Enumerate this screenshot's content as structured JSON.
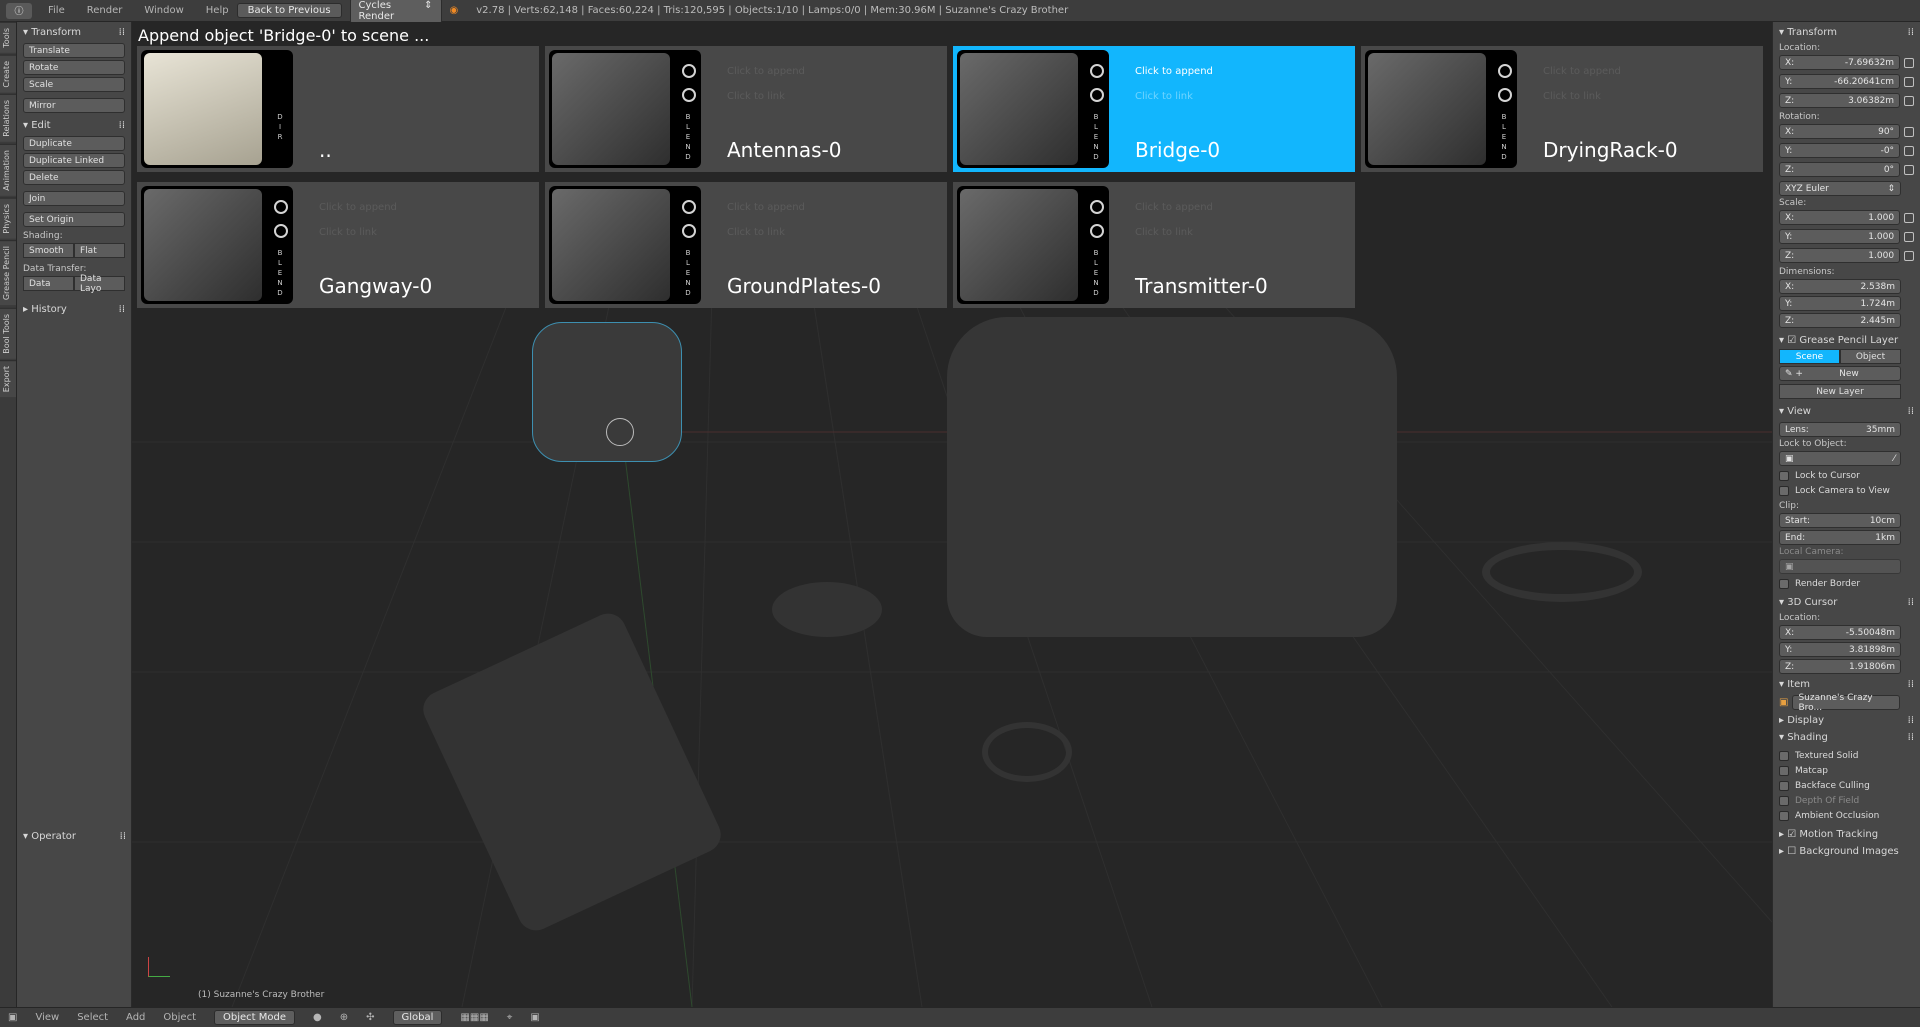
{
  "topbar": {
    "menus": [
      "File",
      "Render",
      "Window",
      "Help"
    ],
    "back_label": "Back to Previous",
    "render_engine": "Cycles Render",
    "stats": "v2.78 | Verts:62,148 | Faces:60,224 | Tris:120,595 | Objects:1/10 | Lamps:0/0 | Mem:30.96M | Suzanne's Crazy Brother"
  },
  "tabs": [
    "Tools",
    "Create",
    "Relations",
    "Animation",
    "Physics",
    "Grease Pencil",
    "Bool Tools",
    "Export"
  ],
  "toolshelf": {
    "transform_title": "Transform",
    "translate": "Translate",
    "rotate": "Rotate",
    "scale": "Scale",
    "mirror": "Mirror",
    "edit_title": "Edit",
    "duplicate": "Duplicate",
    "duplicate_linked": "Duplicate Linked",
    "delete": "Delete",
    "join": "Join",
    "set_origin": "Set Origin",
    "shading_label": "Shading:",
    "smooth": "Smooth",
    "flat": "Flat",
    "data_transfer_label": "Data Transfer:",
    "data": "Data",
    "data_layo": "Data Layo",
    "history": "History",
    "operator": "Operator"
  },
  "viewport": {
    "status": "Append object 'Bridge-0' to scene ...",
    "object_label": "(1) Suzanne's Crazy Brother"
  },
  "browser": {
    "click_append": "Click to append",
    "click_link": "Click to link",
    "items": [
      {
        "name": "..",
        "type": "D\nI\nR",
        "selected": false
      },
      {
        "name": "Antennas-0",
        "type": "B\nL\nE\nN\nD",
        "selected": false
      },
      {
        "name": "Bridge-0",
        "type": "B\nL\nE\nN\nD",
        "selected": true
      },
      {
        "name": "DryingRack-0",
        "type": "B\nL\nE\nN\nD",
        "selected": false
      },
      {
        "name": "Gangway-0",
        "type": "B\nL\nE\nN\nD",
        "selected": false
      },
      {
        "name": "GroundPlates-0",
        "type": "B\nL\nE\nN\nD",
        "selected": false
      },
      {
        "name": "Transmitter-0",
        "type": "B\nL\nE\nN\nD",
        "selected": false
      }
    ]
  },
  "properties": {
    "transform_title": "Transform",
    "location_label": "Location:",
    "loc_x": "-7.69632m",
    "loc_y": "-66.20641cm",
    "loc_z": "3.06382m",
    "rotation_label": "Rotation:",
    "rot_x": "90°",
    "rot_y": "-0°",
    "rot_z": "0°",
    "rotation_mode": "XYZ Euler",
    "scale_label": "Scale:",
    "scale_x": "1.000",
    "scale_y": "1.000",
    "scale_z": "1.000",
    "dimensions_label": "Dimensions:",
    "dim_x": "2.538m",
    "dim_y": "1.724m",
    "dim_z": "2.445m",
    "grease_title": "Grease Pencil Layer",
    "scene_tab": "Scene",
    "object_tab": "Object",
    "new_btn": "New",
    "new_layer": "New Layer",
    "view_title": "View",
    "lens_label": "Lens:",
    "lens_value": "35mm",
    "lock_to_object": "Lock to Object:",
    "lock_to_cursor": "Lock to Cursor",
    "lock_camera": "Lock Camera to View",
    "clip_label": "Clip:",
    "clip_start_label": "Start:",
    "clip_start": "10cm",
    "clip_end_label": "End:",
    "clip_end": "1km",
    "local_camera": "Local Camera:",
    "render_border": "Render Border",
    "cursor_title": "3D Cursor",
    "cursor_location": "Location:",
    "cur_x": "-5.50048m",
    "cur_y": "3.81898m",
    "cur_z": "1.91806m",
    "item_title": "Item",
    "item_name": "Suzanne's Crazy Bro...",
    "display_title": "Display",
    "shading_title": "Shading",
    "textured_solid": "Textured Solid",
    "matcap": "Matcap",
    "backface": "Backface Culling",
    "dof": "Depth Of Field",
    "ao": "Ambient Occlusion",
    "motion_tracking": "Motion Tracking",
    "background_images": "Background Images"
  },
  "bottombar": {
    "menus": [
      "View",
      "Select",
      "Add",
      "Object"
    ],
    "mode": "Object Mode",
    "orientation": "Global"
  },
  "colors": {
    "accent": "#12b6fd",
    "panel": "#474747",
    "viewport": "#262626"
  }
}
